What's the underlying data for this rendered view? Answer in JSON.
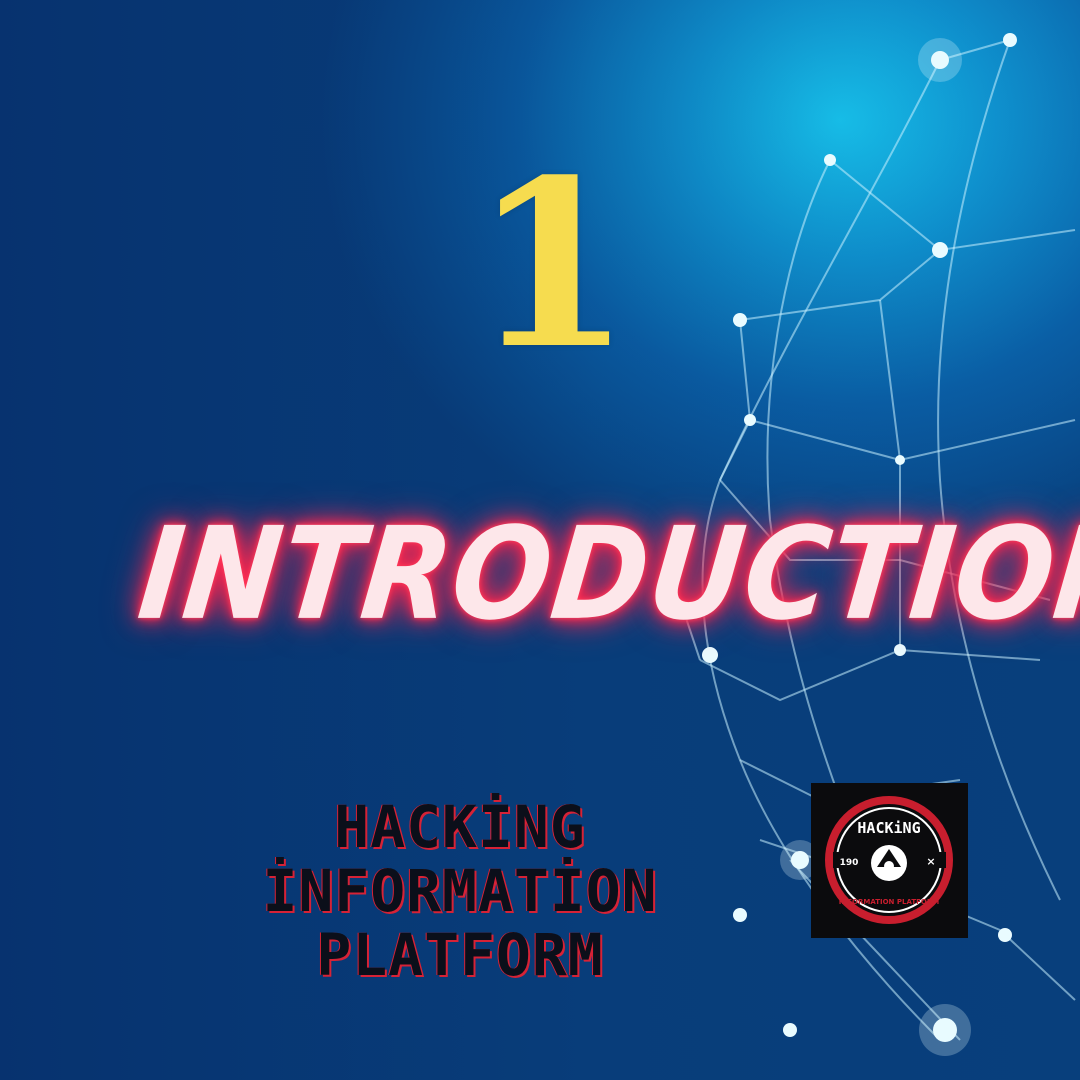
{
  "slide": {
    "number": "1",
    "title": "INTRODUCTION",
    "brand_line1": "HACKİNG İNFORMATİON",
    "brand_line2": "PLATFORM"
  },
  "logo": {
    "top_text": "HACKiNG",
    "ring_text": "INFORMATION PLATFORM",
    "left_badge": "190",
    "right_badge": "×"
  },
  "colors": {
    "number": "#f6dc4f",
    "title_fill": "#fde7ea",
    "title_glow": "#ff2a4d",
    "brand_text": "#0b0f1a",
    "brand_shadow": "#d62236",
    "logo_ring": "#c81e2e"
  },
  "icons": [
    "network-globe-background",
    "hacking-platform-logo-icon"
  ]
}
